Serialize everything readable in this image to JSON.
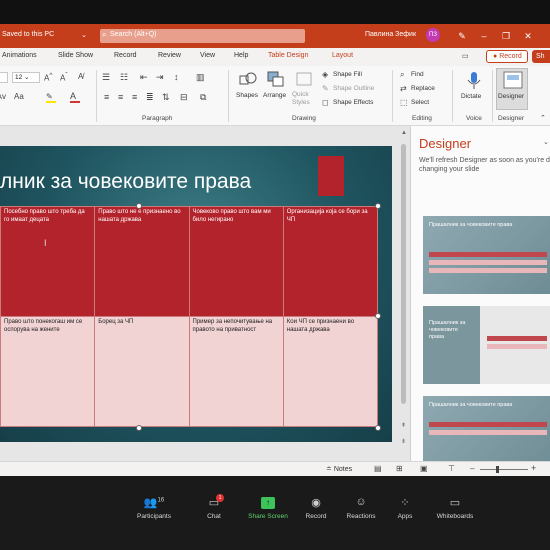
{
  "titlebar": {
    "saved": "Saved to this PC",
    "search": "Search (Alt+Q)",
    "user": "Павлина Зефик",
    "initials": "ПЗ"
  },
  "tabs": [
    "Animations",
    "Slide Show",
    "Record",
    "Review",
    "View",
    "Help",
    "Table Design",
    "Layout"
  ],
  "record_label": "Record",
  "share_label": "Sh",
  "ribbon": {
    "font_size": "12",
    "groups": {
      "paragraph": "Paragraph",
      "drawing": "Drawing",
      "editing": "Editing",
      "voice": "Voice",
      "designer": "Designer"
    },
    "shapes": "Shapes",
    "arrange": "Arrange",
    "quick_styles": "Quick Styles",
    "shape_fill": "Shape Fill",
    "shape_outline": "Shape Outline",
    "shape_effects": "Shape Effects",
    "find": "Find",
    "replace": "Replace",
    "select": "Select",
    "dictate": "Dictate",
    "designer_btn": "Designer"
  },
  "slide": {
    "title": "лник за човековите права",
    "table": [
      [
        "Посебно право што треба да го имаат децата",
        "Право што не е признаено во нашата држава",
        "Човеково право што вам ми било негирано",
        "Организација која се бори за ЧП"
      ],
      [
        "Право што понекогаш им се оспорува на жените",
        "Борец за ЧП",
        "Пример за непочитување на правото на приватност",
        "Кои ЧП се признаени во нашата држава"
      ]
    ]
  },
  "designer": {
    "title": "Designer",
    "message": "We'll refresh Designer as soon as you're d changing your slide",
    "thumb_title": "Прашалник за човековите права"
  },
  "status": {
    "notes": "Notes"
  },
  "zoom": {
    "participants_count": "16",
    "chat_badge": "1",
    "items": [
      "Participants",
      "Chat",
      "Share Screen",
      "Record",
      "Reactions",
      "Apps",
      "Whiteboards"
    ]
  }
}
